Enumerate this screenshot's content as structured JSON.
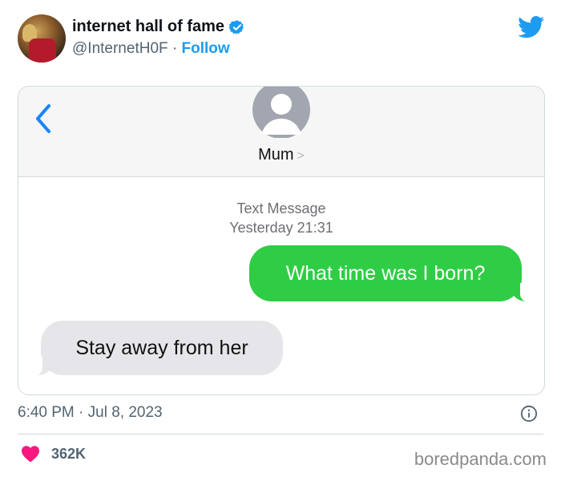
{
  "author": {
    "display_name": "internet hall of fame",
    "handle": "@InternetH0F",
    "separator": "·",
    "follow_label": "Follow",
    "verified": true
  },
  "imessage": {
    "contact_name": "Mum",
    "contact_chevron": ">",
    "meta_line1": "Text Message",
    "meta_line2": "Yesterday 21:31",
    "messages": [
      {
        "direction": "outgoing",
        "text": "What time was I born?"
      },
      {
        "direction": "incoming",
        "text": "Stay away from her"
      }
    ]
  },
  "tweet": {
    "timestamp": "6:40 PM · Jul 8, 2023",
    "likes": "362K"
  },
  "watermark": "boredpanda.com",
  "colors": {
    "twitter_blue": "#1d9bf0",
    "imessage_green": "#2fcd45",
    "incoming_gray": "#e5e5ea",
    "heart_pink": "#f91880",
    "ios_blue": "#1a84ff"
  },
  "icons": [
    "verified-badge-icon",
    "twitter-bird-icon",
    "back-chevron-icon",
    "contact-avatar-icon",
    "info-icon",
    "heart-icon"
  ]
}
